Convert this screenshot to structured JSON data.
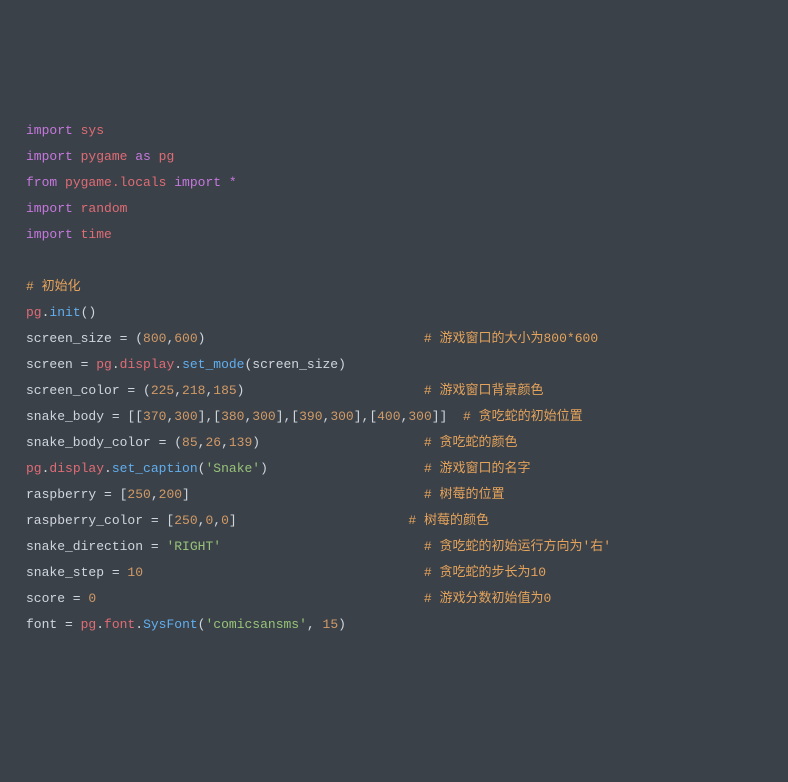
{
  "colors": {
    "background": "#3a4149",
    "default": "#d0d6dc",
    "keyword": "#c678dd",
    "name": "#e06c75",
    "number": "#d19a66",
    "string": "#98c379",
    "comment": "#e5a35b",
    "function": "#61afef"
  },
  "lines": {
    "l1": {
      "t1": "import",
      "t2": " sys"
    },
    "l2": {
      "t1": "import",
      "t2": " pygame ",
      "t3": "as",
      "t4": " pg"
    },
    "l3": {
      "t1": "from",
      "t2": " pygame.locals ",
      "t3": "import",
      "t4": " *"
    },
    "l4": {
      "t1": "import",
      "t2": " random"
    },
    "l5": {
      "t1": "import",
      "t2": " time"
    },
    "blank1": " ",
    "l6": {
      "c": "# 初始化"
    },
    "l7": {
      "t1": "pg",
      "t2": ".",
      "t3": "init",
      "t4": "()"
    },
    "l8": {
      "t1": "screen_size = (",
      "n1": "800",
      "t2": ",",
      "n2": "600",
      "t3": ")",
      "pad": "                            ",
      "c": "# 游戏窗口的大小为800*600"
    },
    "l9": {
      "t1": "screen = ",
      "t2": "pg",
      "t3": ".",
      "t4": "display",
      "t5": ".",
      "t6": "set_mode",
      "t7": "(screen_size)"
    },
    "l10": {
      "t1": "screen_color = (",
      "n1": "225",
      "t2": ",",
      "n2": "218",
      "t3": ",",
      "n3": "185",
      "t4": ")",
      "pad": "                       ",
      "c": "# 游戏窗口背景颜色"
    },
    "l11": {
      "t1": "snake_body = [[",
      "n1": "370",
      "t2": ",",
      "n2": "300",
      "t3": "],[",
      "n3": "380",
      "t4": ",",
      "n4": "300",
      "t5": "],[",
      "n5": "390",
      "t6": ",",
      "n6": "300",
      "t7": "],[",
      "n7": "400",
      "t8": ",",
      "n8": "300",
      "t9": "]]",
      "pad": "  ",
      "c": "# 贪吃蛇的初始位置"
    },
    "l12": {
      "t1": "snake_body_color = (",
      "n1": "85",
      "t2": ",",
      "n2": "26",
      "t3": ",",
      "n3": "139",
      "t4": ")",
      "pad": "                     ",
      "c": "# 贪吃蛇的颜色"
    },
    "l13": {
      "t1": "pg",
      "t2": ".",
      "t3": "display",
      "t4": ".",
      "t5": "set_caption",
      "t6": "(",
      "s1": "'Snake'",
      "t7": ")",
      "pad": "                    ",
      "c": "# 游戏窗口的名字"
    },
    "l14": {
      "t1": "raspberry = [",
      "n1": "250",
      "t2": ",",
      "n2": "200",
      "t3": "]",
      "pad": "                              ",
      "c": "# 树莓的位置"
    },
    "l15": {
      "t1": "raspberry_color = [",
      "n1": "250",
      "t2": ",",
      "n2": "0",
      "t3": ",",
      "n3": "0",
      "t4": "]",
      "pad": "                      ",
      "c": "# 树莓的颜色"
    },
    "l16": {
      "t1": "snake_direction = ",
      "s1": "'RIGHT'",
      "pad": "                          ",
      "c": "# 贪吃蛇的初始运行方向为'右'"
    },
    "l17": {
      "t1": "snake_step = ",
      "n1": "10",
      "pad": "                                    ",
      "c": "# 贪吃蛇的步长为10"
    },
    "l18": {
      "t1": "score = ",
      "n1": "0",
      "pad": "                                          ",
      "c": "# 游戏分数初始值为0"
    },
    "l19": {
      "t1": "font = ",
      "t2": "pg",
      "t3": ".",
      "t4": "font",
      "t5": ".",
      "t6": "SysFont",
      "t7": "(",
      "s1": "'comicsansms'",
      "t8": ", ",
      "n1": "15",
      "t9": ")"
    }
  }
}
